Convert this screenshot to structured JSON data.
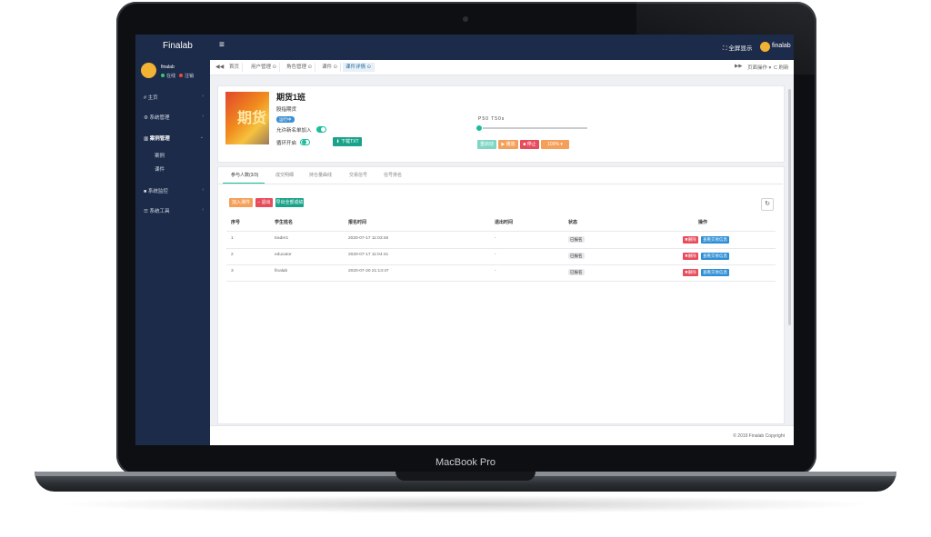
{
  "device": {
    "label": "MacBook Pro"
  },
  "app": {
    "title": "Finalab",
    "menu_icon": "≡",
    "fullscreen": "⛶ 全屏显示",
    "user": "finalab"
  },
  "sidebar": {
    "user_name": "finalab",
    "online": "在线",
    "logout": "注销",
    "items": [
      {
        "label": "主页"
      },
      {
        "label": "系统管理"
      },
      {
        "label": "案例管理"
      },
      {
        "label": "系统监控"
      },
      {
        "label": "系统工具"
      }
    ],
    "subitems": [
      "案例",
      "课件"
    ]
  },
  "tabs": {
    "nav_left": "◀◀",
    "items": [
      "首页",
      "用户管理 ⊙",
      "角色管理 ⊙",
      "课件 ⊙",
      "课件详情 ⊙"
    ],
    "nav_right": "▶▶",
    "page_ops": "页面操作 ▾",
    "refresh": "C 刷新"
  },
  "course": {
    "cover_text": "期货",
    "title": "期货1班",
    "type": "股指期货",
    "status_badge": "运行中",
    "allow_label": "允许新名单加入",
    "loop_label": "循环开启",
    "download_btn": "⬇ 下载TXT",
    "speed_label": "P50     T50s",
    "controls": [
      "重启动",
      "▶ 播放",
      "■ 停止",
      "100% ▾"
    ],
    "progress_pct": 0
  },
  "inner_tabs": [
    "参与人数(3/3)",
    "成交明细",
    "持仓量曲线",
    "交易信号",
    "信号排名"
  ],
  "toolbar": {
    "add": "加入课件",
    "remove": "− 退出",
    "export": "导出全部成绩"
  },
  "table": {
    "headers": [
      "序号",
      "学生姓名",
      "报名时间",
      "退出时间",
      "状态",
      "操作"
    ],
    "rows": [
      {
        "no": "1",
        "name": "trader1",
        "time": "2020-07-17 11:03:46",
        "exit": "-",
        "state": "已报名",
        "del": "✖删除",
        "view": "查看交易信息"
      },
      {
        "no": "2",
        "name": "educator",
        "time": "2020-07-17 11:04:41",
        "exit": "-",
        "state": "已报名",
        "del": "✖删除",
        "view": "查看交易信息"
      },
      {
        "no": "3",
        "name": "finalab",
        "time": "2020-07-20 21:13:47",
        "exit": "-",
        "state": "已报名",
        "del": "✖删除",
        "view": "查看交易信息"
      }
    ]
  },
  "footer": {
    "copyright": "© 2019 Finalab Copyright"
  },
  "colors": {
    "sidebar": "#1d2b4a",
    "accent": "#1abc9c",
    "danger": "#e74c5c",
    "primary": "#2f8fd6",
    "orange": "#f5a05a"
  }
}
